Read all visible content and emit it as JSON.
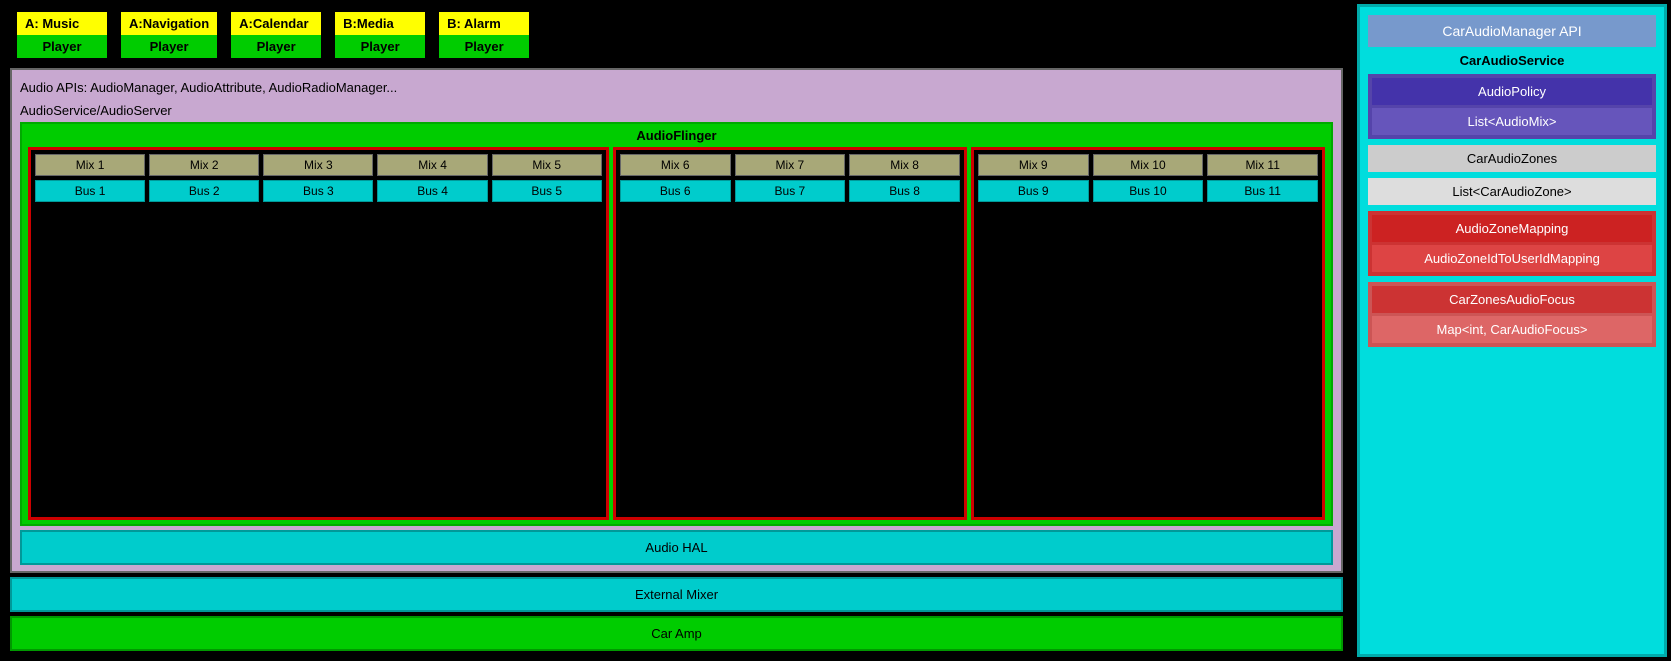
{
  "appBoxes": [
    {
      "id": "a-music",
      "label": "A: Music",
      "player": "Player"
    },
    {
      "id": "a-navigation",
      "label": "A:Navigation",
      "player": "Player"
    },
    {
      "id": "a-calendar",
      "label": "A:Calendar",
      "player": "Player"
    },
    {
      "id": "b-media",
      "label": "B:Media",
      "player": "Player"
    },
    {
      "id": "b-alarm",
      "label": "B: Alarm",
      "player": "Player"
    }
  ],
  "audioApis": "Audio APIs: AudioManager, AudioAttribute, AudioRadioManager...",
  "audioService": "AudioService/AudioServer",
  "audioFlinger": "AudioFlinger",
  "audioHal": "Audio HAL",
  "externalMixer": "External Mixer",
  "carAmp": "Car Amp",
  "zones": [
    {
      "id": "zone-a",
      "mixes": [
        "Mix 1",
        "Mix 2",
        "Mix 3",
        "Mix 4",
        "Mix 5"
      ],
      "buses": [
        "Bus 1",
        "Bus 2",
        "Bus 3",
        "Bus 4",
        "Bus 5"
      ]
    },
    {
      "id": "zone-b",
      "mixes": [
        "Mix 6",
        "Mix 7",
        "Mix 8"
      ],
      "buses": [
        "Bus 6",
        "Bus 7",
        "Bus 8"
      ]
    },
    {
      "id": "zone-c",
      "mixes": [
        "Mix 9",
        "Mix 10",
        "Mix 11"
      ],
      "buses": [
        "Bus 9",
        "Bus 10",
        "Bus 11"
      ]
    }
  ],
  "rightPanel": {
    "carAudioManagerApi": "CarAudioManager API",
    "carAudioService": "CarAudioService",
    "audioPolicy": "AudioPolicy",
    "listAudioMix": "List<AudioMix>",
    "carAudioZones": "CarAudioZones",
    "listCarAudioZone": "List<CarAudioZone>",
    "audioZoneMapping": "AudioZoneMapping",
    "audioZoneIdToUserIdMapping": "AudioZoneIdToUserIdMapping",
    "carZonesAudioFocus": "CarZonesAudioFocus",
    "mapCarAudioFocus": "Map<int, CarAudioFocus>"
  }
}
